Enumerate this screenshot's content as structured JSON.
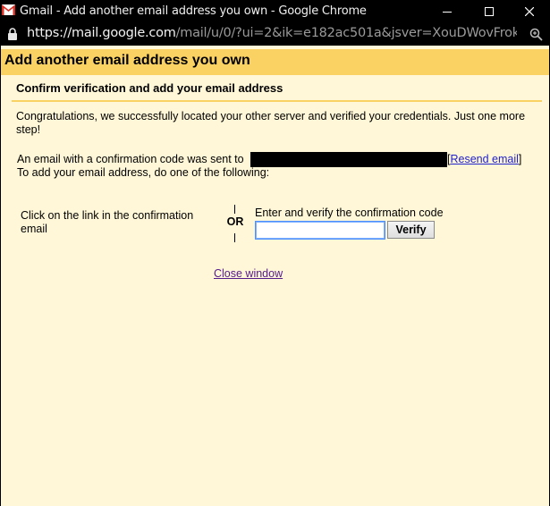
{
  "window": {
    "title": "Gmail - Add another email address you own - Google Chrome",
    "favicon": "gmail-icon",
    "controls": [
      "minimize-icon",
      "maximize-icon",
      "close-icon"
    ]
  },
  "addressbar": {
    "url_host": "https://mail.google.com",
    "url_path": "/mail/u/0/?ui=2&ik=e182ac501a&jsver=XouDWovFrok.en.&cb...",
    "lock_icon": "lock-icon",
    "zoom_icon": "zoom-icon"
  },
  "page": {
    "header_title": "Add another email address you own",
    "section_title": "Confirm verification and add your email address",
    "congrats_text": "Congratulations, we successfully located your other server and verified your credentials. Just one more step!",
    "sent_text": "An email with a confirmation code was sent to",
    "resend_open": "[",
    "resend_label": "Resend email",
    "resend_close": "]",
    "todo_text": "To add your email address, do one of the following:",
    "option_link_text": "Click on the link in the confirmation email",
    "or_text": "OR",
    "option_code_label": "Enter and verify the confirmation code",
    "code_input_value": "",
    "verify_label": "Verify",
    "close_label": "Close window"
  },
  "colors": {
    "header_bg": "#fad163",
    "page_bg": "#fff7d7",
    "link": "#2222cc",
    "visited_link": "#551a8b"
  }
}
